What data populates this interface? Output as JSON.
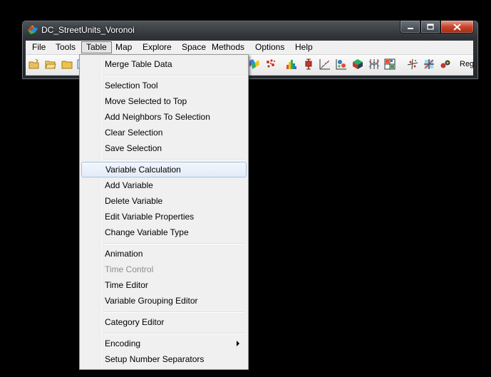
{
  "window": {
    "title": "DC_StreetUnits_Voronoi"
  },
  "menubar": {
    "items": [
      {
        "label": "File"
      },
      {
        "label": "Tools"
      },
      {
        "label": "Table"
      },
      {
        "label": "Map"
      },
      {
        "label": "Explore"
      },
      {
        "label": "Space"
      },
      {
        "label": "Methods"
      },
      {
        "label": "Options"
      },
      {
        "label": "Help"
      }
    ],
    "open_item": "Table"
  },
  "toolbar": {
    "icons": [
      "open-project-icon",
      "open-folder-icon",
      "folder-icon",
      "map-window-icon",
      "voronoi-icon",
      "cluster-map-icon",
      "histogram-icon",
      "box-plot-icon",
      "scatter-plot-icon",
      "bubble-chart-icon",
      "3d-plot-icon",
      "parallel-coordinate-icon",
      "conditional-plot-icon",
      "cartogram-icon",
      "lisa-icon",
      "local-g-icon",
      "regression-icon"
    ],
    "regression_label": "Reg"
  },
  "table_menu": {
    "items": [
      {
        "label": "Merge Table Data",
        "enabled": true
      },
      {
        "label": "Selection Tool",
        "enabled": true
      },
      {
        "label": "Move Selected to Top",
        "enabled": true
      },
      {
        "label": "Add Neighbors To Selection",
        "enabled": true
      },
      {
        "label": "Clear Selection",
        "enabled": true
      },
      {
        "label": "Save Selection",
        "enabled": true
      },
      {
        "label": "Variable Calculation",
        "enabled": true,
        "highlighted": true
      },
      {
        "label": "Add Variable",
        "enabled": true
      },
      {
        "label": "Delete Variable",
        "enabled": true
      },
      {
        "label": "Edit Variable Properties",
        "enabled": true
      },
      {
        "label": "Change Variable Type",
        "enabled": true
      },
      {
        "label": "Animation",
        "enabled": true
      },
      {
        "label": "Time Control",
        "enabled": false
      },
      {
        "label": "Time Editor",
        "enabled": true
      },
      {
        "label": "Variable Grouping Editor",
        "enabled": true
      },
      {
        "label": "Category Editor",
        "enabled": true
      },
      {
        "label": "Encoding",
        "enabled": true,
        "submenu": true
      },
      {
        "label": "Setup Number Separators",
        "enabled": true
      }
    ]
  },
  "colors": {
    "background": "#000000",
    "menu_bg": "#f0f0f0",
    "highlight_border": "#a8c4e6",
    "disabled_text": "#8d8d8d",
    "close_button": "#c9462c"
  }
}
